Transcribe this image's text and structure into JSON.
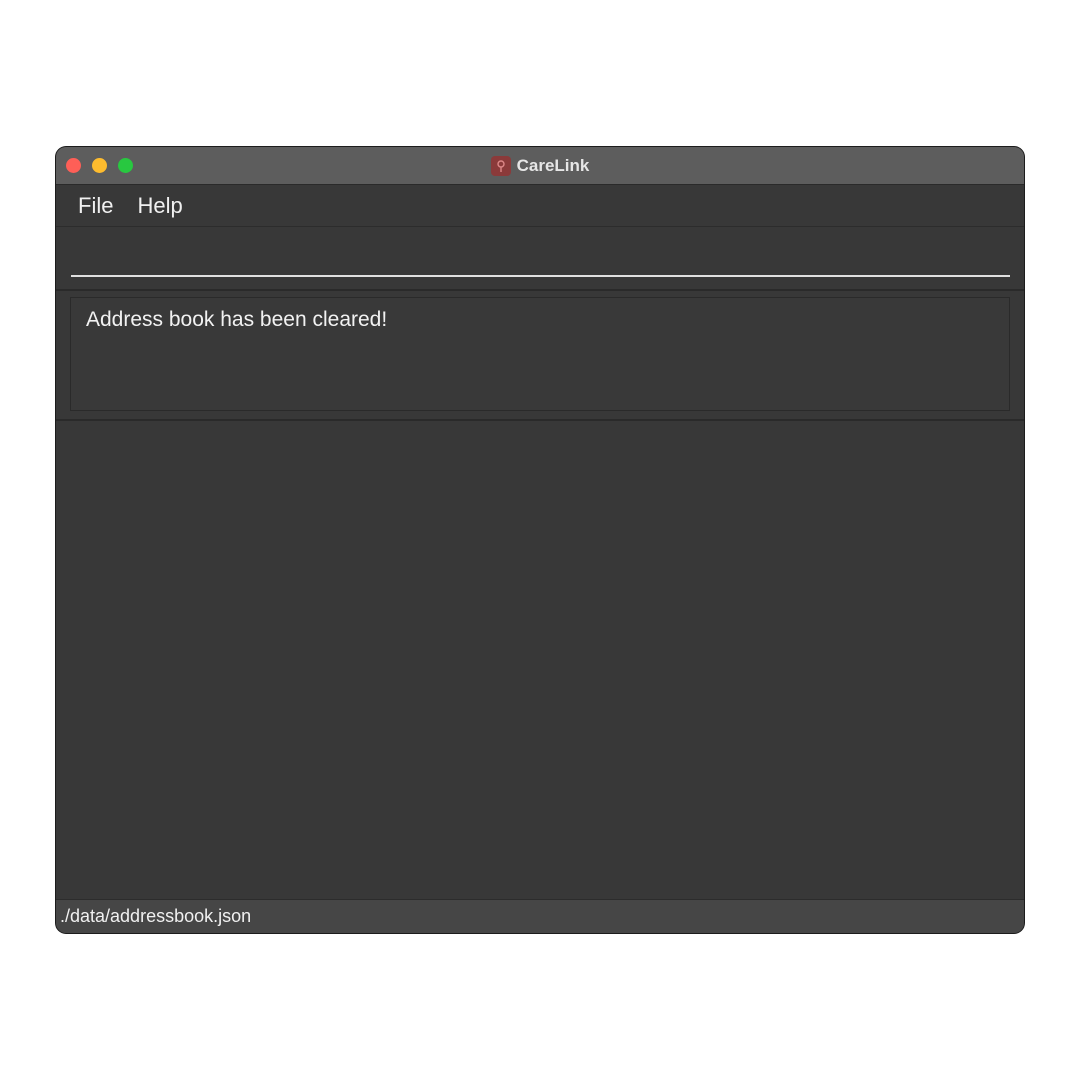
{
  "window": {
    "title": "CareLink",
    "app_icon": "carelink-app-icon"
  },
  "menu": {
    "items": [
      {
        "label": "File"
      },
      {
        "label": "Help"
      }
    ]
  },
  "command": {
    "value": "",
    "placeholder": ""
  },
  "result": {
    "message": "Address book has been cleared!"
  },
  "status": {
    "save_location": "./data/addressbook.json"
  },
  "colors": {
    "close": "#fe5f57",
    "minimize": "#febc2e",
    "maximize": "#28c840",
    "background": "#383838"
  }
}
